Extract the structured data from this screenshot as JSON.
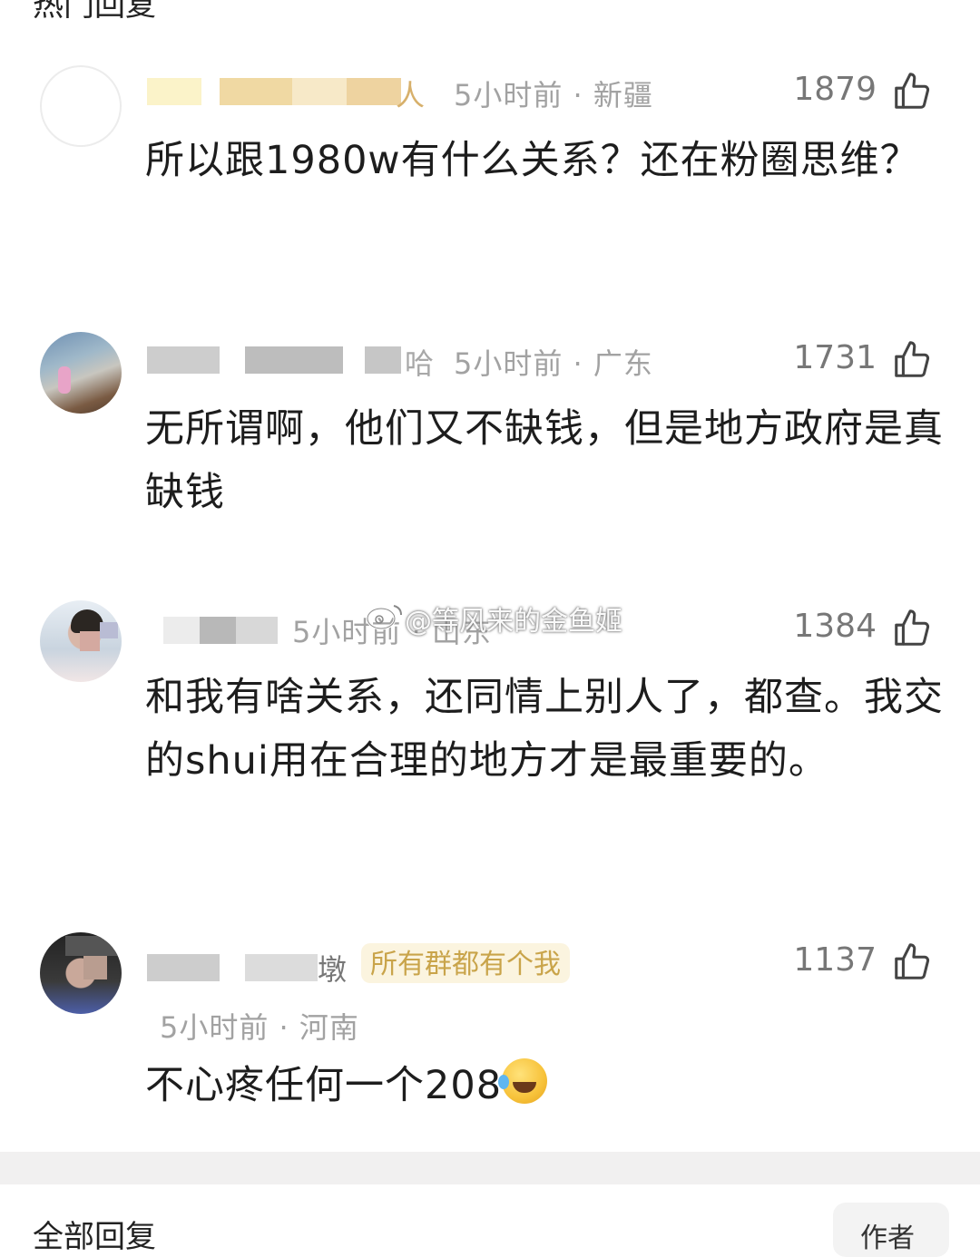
{
  "header_partial": "热门回复",
  "watermark": "@等风来的金鱼姬",
  "comments": [
    {
      "name_tail": "人",
      "time": "5小时前",
      "location": "新疆",
      "likes": "1879",
      "text": "所以跟1980w有什么关系？还在粉圈思维？"
    },
    {
      "name_tail": "哈",
      "time": "5小时前",
      "location": "广东",
      "likes": "1731",
      "text": "无所谓啊，他们又不缺钱，但是地方政府是真缺钱"
    },
    {
      "name_tail": "",
      "time": "5小时前",
      "location": "山东",
      "likes": "1384",
      "text": "和我有啥关系，还同情上别人了，都查。我交的shui用在合理的地方才是最重要的。"
    },
    {
      "name_tail": "墩",
      "badge": "所有群都有个我",
      "time": "5小时前",
      "location": "河南",
      "likes": "1137",
      "text": "不心疼任何一个208"
    }
  ],
  "footer_partial": "全部回复",
  "footer_button": "作者"
}
